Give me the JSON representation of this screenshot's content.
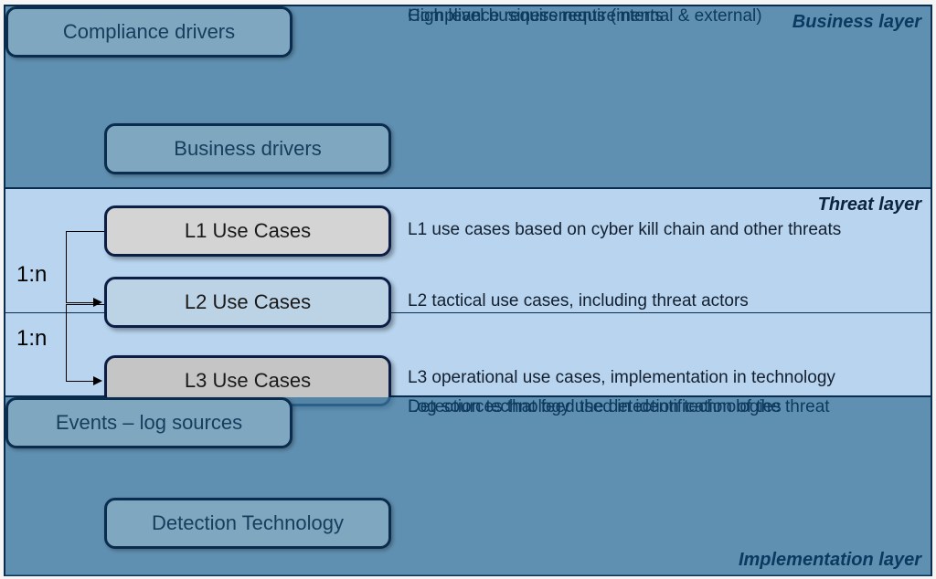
{
  "layers": {
    "business": {
      "label": "Business layer",
      "rows": [
        {
          "box": "Business drivers",
          "desc": "High level business requirements"
        },
        {
          "box": "Compliance drivers",
          "desc": "Compliance requirements (internal & external)"
        }
      ]
    },
    "threat": {
      "label": "Threat layer",
      "ratios": [
        "1:n",
        "1:n"
      ],
      "rows": [
        {
          "box": "L1 Use Cases",
          "desc": "L1 use cases based on cyber kill chain and other threats"
        },
        {
          "box": "L2 Use Cases",
          "desc": "L2 tactical use cases, including threat actors"
        },
        {
          "box": "L3 Use Cases",
          "desc": "L3 operational use cases, implementation in technology"
        }
      ]
    },
    "implementation": {
      "label": "Implementation  layer",
      "rows": [
        {
          "box": "Detection Technology",
          "desc": "Detection technology used in identification of the threat"
        },
        {
          "box": "Events – log sources",
          "desc": "Log sources that feed the detection technologies"
        }
      ]
    }
  }
}
